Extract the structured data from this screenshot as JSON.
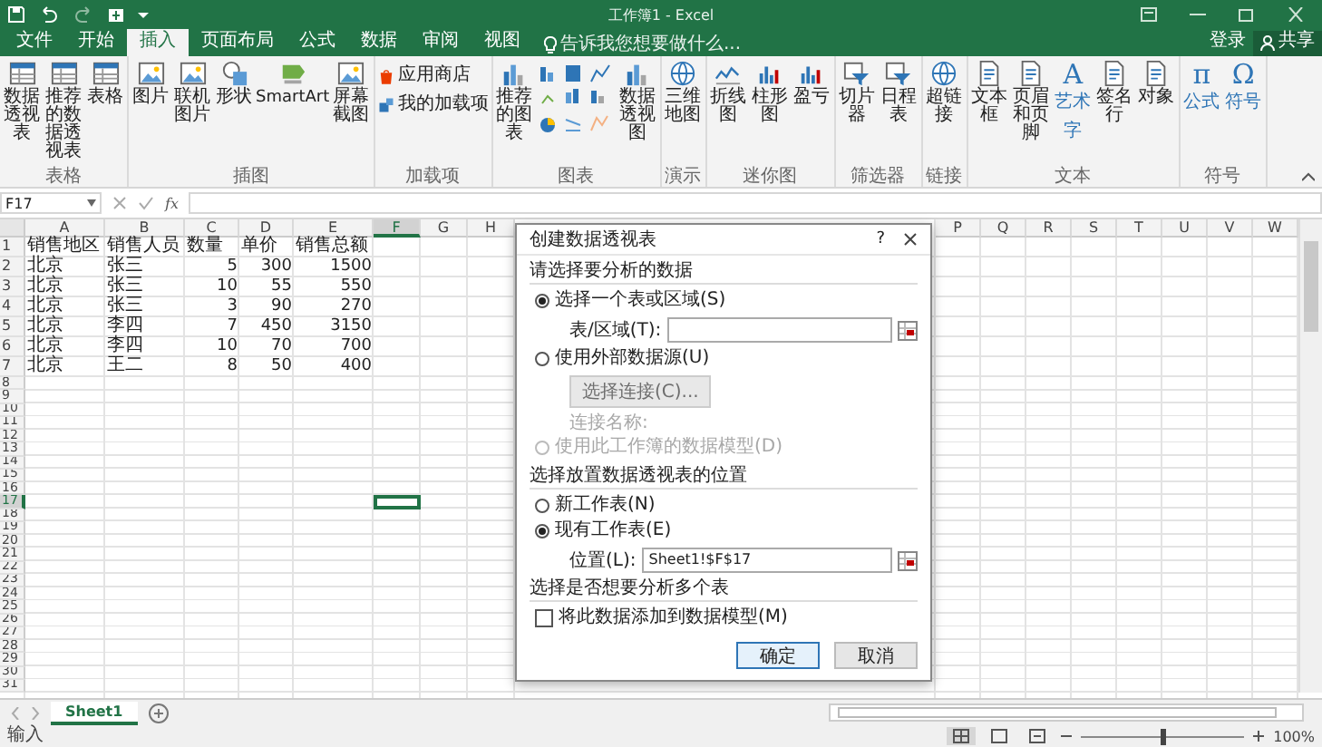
{
  "title_bar": {
    "title": "工作簿1 - Excel"
  },
  "ribbon_tabs": [
    {
      "label": "文件",
      "selected": false
    },
    {
      "label": "开始",
      "selected": false
    },
    {
      "label": "插入",
      "selected": true
    },
    {
      "label": "页面布局",
      "selected": false
    },
    {
      "label": "公式",
      "selected": false
    },
    {
      "label": "数据",
      "selected": false
    },
    {
      "label": "审阅",
      "selected": false
    },
    {
      "label": "视图",
      "selected": false
    }
  ],
  "tell_me": {
    "placeholder": "告诉我您想要做什么..."
  },
  "account": {
    "sign_in": "登录",
    "share": "共享"
  },
  "ribbon_groups": [
    {
      "label": "表格",
      "items": [
        {
          "kind": "large",
          "label": "数据透视表"
        },
        {
          "kind": "large",
          "label": "推荐的数据透视表"
        },
        {
          "kind": "large",
          "label": "表格"
        }
      ]
    },
    {
      "label": "插图",
      "items": [
        {
          "kind": "large",
          "label": "图片"
        },
        {
          "kind": "large",
          "label": "联机图片"
        },
        {
          "kind": "large",
          "label": "形状"
        },
        {
          "kind": "wide",
          "label": "SmartArt"
        },
        {
          "kind": "large",
          "label": "屏幕截图"
        }
      ]
    },
    {
      "label": "加载项",
      "items": [
        {
          "kind": "small",
          "label": "应用商店"
        },
        {
          "kind": "small",
          "label": "我的加载项"
        }
      ]
    },
    {
      "label": "图表",
      "items": [
        {
          "kind": "large",
          "label": "推荐的图表"
        },
        {
          "kind": "gallery"
        },
        {
          "kind": "large",
          "label": "数据透视图"
        }
      ]
    },
    {
      "label": "演示",
      "items": [
        {
          "kind": "large",
          "label": "三维地图"
        }
      ]
    },
    {
      "label": "迷你图",
      "items": [
        {
          "kind": "large",
          "label": "折线图"
        },
        {
          "kind": "large",
          "label": "柱形图"
        },
        {
          "kind": "large",
          "label": "盈亏"
        }
      ]
    },
    {
      "label": "筛选器",
      "items": [
        {
          "kind": "large",
          "label": "切片器"
        },
        {
          "kind": "large",
          "label": "日程表"
        }
      ]
    },
    {
      "label": "链接",
      "items": [
        {
          "kind": "large",
          "label": "超链接"
        }
      ]
    },
    {
      "label": "文本",
      "items": [
        {
          "kind": "large",
          "label": "文本框"
        },
        {
          "kind": "large",
          "label": "页眉和页脚"
        },
        {
          "kind": "glyph",
          "glyph": "A",
          "label": "艺术字"
        },
        {
          "kind": "large",
          "label": "签名行"
        },
        {
          "kind": "large",
          "label": "对象"
        }
      ]
    },
    {
      "label": "符号",
      "items": [
        {
          "kind": "glyph",
          "glyph": "π",
          "label": "公式"
        },
        {
          "kind": "glyph",
          "glyph": "Ω",
          "label": "符号"
        }
      ]
    }
  ],
  "formula_bar": {
    "name_box": "F17",
    "function_label": "fx"
  },
  "sheet": {
    "columns": [
      {
        "label": "A",
        "selected": false
      },
      {
        "label": "B",
        "selected": false
      },
      {
        "label": "C",
        "selected": false
      },
      {
        "label": "D",
        "selected": false
      },
      {
        "label": "E",
        "selected": false
      },
      {
        "label": "F",
        "selected": true
      },
      {
        "label": "G",
        "selected": false
      },
      {
        "label": "H",
        "selected": false
      }
    ],
    "columns_right": [
      {
        "label": "P"
      },
      {
        "label": "Q"
      },
      {
        "label": "R"
      },
      {
        "label": "S"
      },
      {
        "label": "T"
      },
      {
        "label": "U"
      },
      {
        "label": "V"
      },
      {
        "label": "W"
      }
    ],
    "rows": [
      {
        "header": "1",
        "selected": false,
        "kind": "heading",
        "cells": [
          "销售地区",
          "销售人员",
          "数量",
          "单价",
          "销售总额"
        ]
      },
      {
        "header": "2",
        "selected": false,
        "kind": "data",
        "cells": [
          "北京",
          "张三",
          "5",
          "300",
          "1500"
        ]
      },
      {
        "header": "3",
        "selected": false,
        "kind": "data",
        "cells": [
          "北京",
          "张三",
          "10",
          "55",
          "550"
        ]
      },
      {
        "header": "4",
        "selected": false,
        "kind": "data",
        "cells": [
          "北京",
          "张三",
          "3",
          "90",
          "270"
        ]
      },
      {
        "header": "5",
        "selected": false,
        "kind": "data",
        "cells": [
          "北京",
          "李四",
          "7",
          "450",
          "3150"
        ]
      },
      {
        "header": "6",
        "selected": false,
        "kind": "data",
        "cells": [
          "北京",
          "李四",
          "10",
          "70",
          "700"
        ]
      },
      {
        "header": "7",
        "selected": false,
        "kind": "data",
        "cells": [
          "北京",
          "王二",
          "8",
          "50",
          "400"
        ]
      },
      {
        "header": "8",
        "selected": false
      },
      {
        "header": "9",
        "selected": false
      },
      {
        "header": "10",
        "selected": false
      },
      {
        "header": "11",
        "selected": false
      },
      {
        "header": "12",
        "selected": false
      },
      {
        "header": "13",
        "selected": false
      },
      {
        "header": "14",
        "selected": false
      },
      {
        "header": "15",
        "selected": false
      },
      {
        "header": "16",
        "selected": false
      },
      {
        "header": "17",
        "selected": true
      },
      {
        "header": "18",
        "selected": false
      },
      {
        "header": "19",
        "selected": false
      },
      {
        "header": "20",
        "selected": false
      },
      {
        "header": "21",
        "selected": false
      },
      {
        "header": "22",
        "selected": false
      },
      {
        "header": "23",
        "selected": false
      },
      {
        "header": "24",
        "selected": false
      },
      {
        "header": "25",
        "selected": false
      },
      {
        "header": "26",
        "selected": false
      },
      {
        "header": "27",
        "selected": false
      },
      {
        "header": "28",
        "selected": false
      },
      {
        "header": "29",
        "selected": false
      },
      {
        "header": "30",
        "selected": false
      },
      {
        "header": "31",
        "selected": false
      }
    ]
  },
  "dialog": {
    "title": "创建数据透视表",
    "help": "?",
    "sections": [
      {
        "heading": "请选择要分析的数据",
        "options": [
          {
            "kind": "radio",
            "label": "选择一个表或区域(S)",
            "selected": true,
            "disabled": false
          },
          {
            "kind": "field",
            "label": "表/区域(T):"
          },
          {
            "kind": "radio",
            "label": "使用外部数据源(U)",
            "selected": false,
            "disabled": false
          },
          {
            "kind": "button",
            "label": "选择连接(C)...",
            "disabled": true
          },
          {
            "kind": "note",
            "label": "连接名称:"
          },
          {
            "kind": "radio",
            "label": "使用此工作簿的数据模型(D)",
            "selected": false,
            "disabled": true
          }
        ]
      },
      {
        "heading": "选择放置数据透视表的位置",
        "options": [
          {
            "kind": "radio",
            "label": "新工作表(N)",
            "selected": false,
            "disabled": false
          },
          {
            "kind": "radio",
            "label": "现有工作表(E)",
            "selected": true,
            "disabled": false
          },
          {
            "kind": "field",
            "label": "位置(L):",
            "value": "Sheet1!$F$17"
          }
        ]
      },
      {
        "heading": "选择是否想要分析多个表",
        "options": [
          {
            "kind": "checkbox",
            "label": "将此数据添加到数据模型(M)",
            "checked": false
          }
        ]
      }
    ],
    "buttons": [
      {
        "label": "确定",
        "default": true
      },
      {
        "label": "取消",
        "default": false
      }
    ]
  },
  "sheet_tabs": [
    {
      "label": "Sheet1",
      "selected": true
    }
  ],
  "status_bar": {
    "mode": "输入",
    "zoom": "100%",
    "zoom_slider": {
      "level": 0.5
    }
  }
}
